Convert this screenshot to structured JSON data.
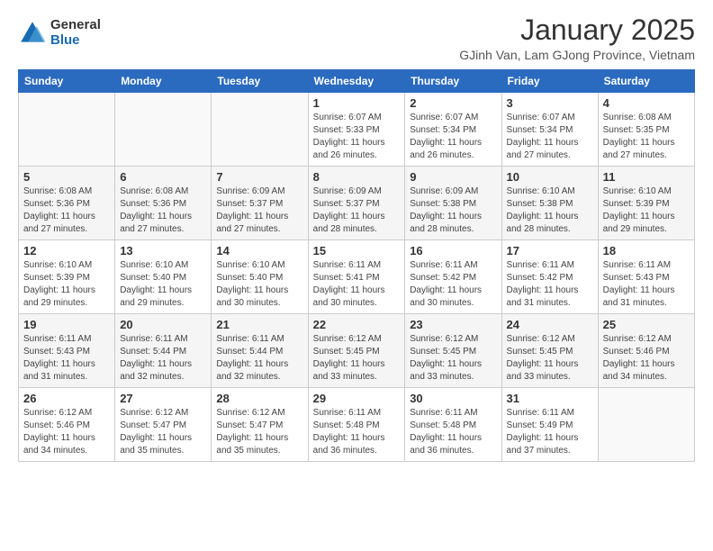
{
  "logo": {
    "general": "General",
    "blue": "Blue"
  },
  "header": {
    "month": "January 2025",
    "location": "GJinh Van, Lam GJong Province, Vietnam"
  },
  "weekdays": [
    "Sunday",
    "Monday",
    "Tuesday",
    "Wednesday",
    "Thursday",
    "Friday",
    "Saturday"
  ],
  "weeks": [
    [
      {
        "day": "",
        "sunrise": "",
        "sunset": "",
        "daylight": ""
      },
      {
        "day": "",
        "sunrise": "",
        "sunset": "",
        "daylight": ""
      },
      {
        "day": "",
        "sunrise": "",
        "sunset": "",
        "daylight": ""
      },
      {
        "day": "1",
        "sunrise": "Sunrise: 6:07 AM",
        "sunset": "Sunset: 5:33 PM",
        "daylight": "Daylight: 11 hours and 26 minutes."
      },
      {
        "day": "2",
        "sunrise": "Sunrise: 6:07 AM",
        "sunset": "Sunset: 5:34 PM",
        "daylight": "Daylight: 11 hours and 26 minutes."
      },
      {
        "day": "3",
        "sunrise": "Sunrise: 6:07 AM",
        "sunset": "Sunset: 5:34 PM",
        "daylight": "Daylight: 11 hours and 27 minutes."
      },
      {
        "day": "4",
        "sunrise": "Sunrise: 6:08 AM",
        "sunset": "Sunset: 5:35 PM",
        "daylight": "Daylight: 11 hours and 27 minutes."
      }
    ],
    [
      {
        "day": "5",
        "sunrise": "Sunrise: 6:08 AM",
        "sunset": "Sunset: 5:36 PM",
        "daylight": "Daylight: 11 hours and 27 minutes."
      },
      {
        "day": "6",
        "sunrise": "Sunrise: 6:08 AM",
        "sunset": "Sunset: 5:36 PM",
        "daylight": "Daylight: 11 hours and 27 minutes."
      },
      {
        "day": "7",
        "sunrise": "Sunrise: 6:09 AM",
        "sunset": "Sunset: 5:37 PM",
        "daylight": "Daylight: 11 hours and 27 minutes."
      },
      {
        "day": "8",
        "sunrise": "Sunrise: 6:09 AM",
        "sunset": "Sunset: 5:37 PM",
        "daylight": "Daylight: 11 hours and 28 minutes."
      },
      {
        "day": "9",
        "sunrise": "Sunrise: 6:09 AM",
        "sunset": "Sunset: 5:38 PM",
        "daylight": "Daylight: 11 hours and 28 minutes."
      },
      {
        "day": "10",
        "sunrise": "Sunrise: 6:10 AM",
        "sunset": "Sunset: 5:38 PM",
        "daylight": "Daylight: 11 hours and 28 minutes."
      },
      {
        "day": "11",
        "sunrise": "Sunrise: 6:10 AM",
        "sunset": "Sunset: 5:39 PM",
        "daylight": "Daylight: 11 hours and 29 minutes."
      }
    ],
    [
      {
        "day": "12",
        "sunrise": "Sunrise: 6:10 AM",
        "sunset": "Sunset: 5:39 PM",
        "daylight": "Daylight: 11 hours and 29 minutes."
      },
      {
        "day": "13",
        "sunrise": "Sunrise: 6:10 AM",
        "sunset": "Sunset: 5:40 PM",
        "daylight": "Daylight: 11 hours and 29 minutes."
      },
      {
        "day": "14",
        "sunrise": "Sunrise: 6:10 AM",
        "sunset": "Sunset: 5:40 PM",
        "daylight": "Daylight: 11 hours and 30 minutes."
      },
      {
        "day": "15",
        "sunrise": "Sunrise: 6:11 AM",
        "sunset": "Sunset: 5:41 PM",
        "daylight": "Daylight: 11 hours and 30 minutes."
      },
      {
        "day": "16",
        "sunrise": "Sunrise: 6:11 AM",
        "sunset": "Sunset: 5:42 PM",
        "daylight": "Daylight: 11 hours and 30 minutes."
      },
      {
        "day": "17",
        "sunrise": "Sunrise: 6:11 AM",
        "sunset": "Sunset: 5:42 PM",
        "daylight": "Daylight: 11 hours and 31 minutes."
      },
      {
        "day": "18",
        "sunrise": "Sunrise: 6:11 AM",
        "sunset": "Sunset: 5:43 PM",
        "daylight": "Daylight: 11 hours and 31 minutes."
      }
    ],
    [
      {
        "day": "19",
        "sunrise": "Sunrise: 6:11 AM",
        "sunset": "Sunset: 5:43 PM",
        "daylight": "Daylight: 11 hours and 31 minutes."
      },
      {
        "day": "20",
        "sunrise": "Sunrise: 6:11 AM",
        "sunset": "Sunset: 5:44 PM",
        "daylight": "Daylight: 11 hours and 32 minutes."
      },
      {
        "day": "21",
        "sunrise": "Sunrise: 6:11 AM",
        "sunset": "Sunset: 5:44 PM",
        "daylight": "Daylight: 11 hours and 32 minutes."
      },
      {
        "day": "22",
        "sunrise": "Sunrise: 6:12 AM",
        "sunset": "Sunset: 5:45 PM",
        "daylight": "Daylight: 11 hours and 33 minutes."
      },
      {
        "day": "23",
        "sunrise": "Sunrise: 6:12 AM",
        "sunset": "Sunset: 5:45 PM",
        "daylight": "Daylight: 11 hours and 33 minutes."
      },
      {
        "day": "24",
        "sunrise": "Sunrise: 6:12 AM",
        "sunset": "Sunset: 5:45 PM",
        "daylight": "Daylight: 11 hours and 33 minutes."
      },
      {
        "day": "25",
        "sunrise": "Sunrise: 6:12 AM",
        "sunset": "Sunset: 5:46 PM",
        "daylight": "Daylight: 11 hours and 34 minutes."
      }
    ],
    [
      {
        "day": "26",
        "sunrise": "Sunrise: 6:12 AM",
        "sunset": "Sunset: 5:46 PM",
        "daylight": "Daylight: 11 hours and 34 minutes."
      },
      {
        "day": "27",
        "sunrise": "Sunrise: 6:12 AM",
        "sunset": "Sunset: 5:47 PM",
        "daylight": "Daylight: 11 hours and 35 minutes."
      },
      {
        "day": "28",
        "sunrise": "Sunrise: 6:12 AM",
        "sunset": "Sunset: 5:47 PM",
        "daylight": "Daylight: 11 hours and 35 minutes."
      },
      {
        "day": "29",
        "sunrise": "Sunrise: 6:11 AM",
        "sunset": "Sunset: 5:48 PM",
        "daylight": "Daylight: 11 hours and 36 minutes."
      },
      {
        "day": "30",
        "sunrise": "Sunrise: 6:11 AM",
        "sunset": "Sunset: 5:48 PM",
        "daylight": "Daylight: 11 hours and 36 minutes."
      },
      {
        "day": "31",
        "sunrise": "Sunrise: 6:11 AM",
        "sunset": "Sunset: 5:49 PM",
        "daylight": "Daylight: 11 hours and 37 minutes."
      },
      {
        "day": "",
        "sunrise": "",
        "sunset": "",
        "daylight": ""
      }
    ]
  ]
}
